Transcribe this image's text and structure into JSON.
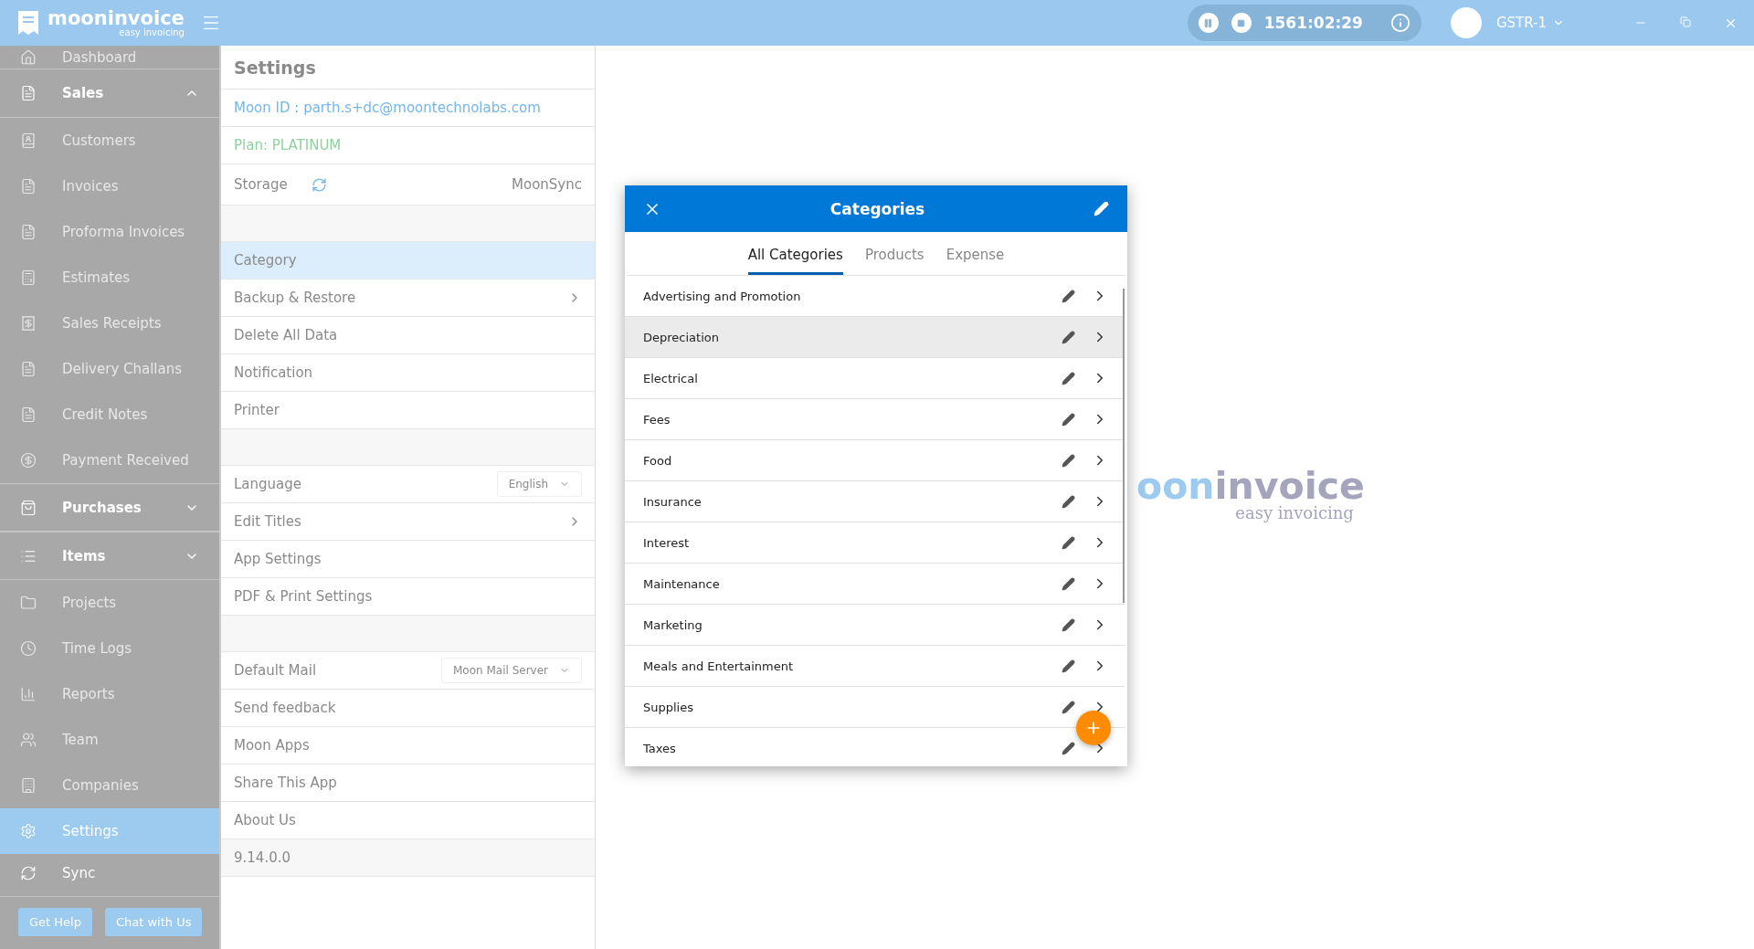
{
  "app": {
    "name": "mooninvoice",
    "tagline": "easy invoicing"
  },
  "timer": {
    "time": "1561:02:29"
  },
  "company": {
    "name": "GSTR-1"
  },
  "sidebar": {
    "items": [
      {
        "label": "Dashboard",
        "kind": "item",
        "selected": false
      },
      {
        "label": "Sales",
        "kind": "section",
        "expanded": true
      },
      {
        "label": "Customers",
        "kind": "item",
        "selected": false
      },
      {
        "label": "Invoices",
        "kind": "item",
        "selected": false
      },
      {
        "label": "Proforma Invoices",
        "kind": "item",
        "selected": false
      },
      {
        "label": "Estimates",
        "kind": "item",
        "selected": false
      },
      {
        "label": "Sales Receipts",
        "kind": "item",
        "selected": false
      },
      {
        "label": "Delivery Challans",
        "kind": "item",
        "selected": false
      },
      {
        "label": "Credit Notes",
        "kind": "item",
        "selected": false
      },
      {
        "label": "Payment Received",
        "kind": "item",
        "selected": false
      },
      {
        "label": "Purchases",
        "kind": "section",
        "expanded": false
      },
      {
        "label": "Items",
        "kind": "section",
        "expanded": false
      },
      {
        "label": "Projects",
        "kind": "item",
        "selected": false
      },
      {
        "label": "Time Logs",
        "kind": "item",
        "selected": false
      },
      {
        "label": "Reports",
        "kind": "item",
        "selected": false
      },
      {
        "label": "Team",
        "kind": "item",
        "selected": false
      },
      {
        "label": "Companies",
        "kind": "item",
        "selected": false
      },
      {
        "label": "Settings",
        "kind": "item",
        "selected": true
      },
      {
        "label": "Sync",
        "kind": "sync"
      }
    ],
    "buttons": [
      "Get Help",
      "Chat with Us"
    ]
  },
  "settings": {
    "title": "Settings",
    "groups": [
      [
        {
          "kind": "id",
          "label": "Moon ID : parth.s+dc@moontechnolabs.com"
        },
        {
          "kind": "plan",
          "label": "Plan: PLATINUM"
        },
        {
          "kind": "storage",
          "label": "Storage",
          "value": "MoonSync"
        }
      ],
      [
        {
          "kind": "row",
          "label": "Category",
          "selected": true
        },
        {
          "kind": "link",
          "label": "Backup & Restore",
          "selected": false
        },
        {
          "kind": "row",
          "label": "Delete All Data",
          "selected": false
        },
        {
          "kind": "row",
          "label": "Notification",
          "selected": false
        },
        {
          "kind": "row",
          "label": "Printer",
          "selected": false
        }
      ],
      [
        {
          "kind": "select",
          "label": "Language",
          "value": "English"
        },
        {
          "kind": "link",
          "label": "Edit Titles",
          "selected": false
        },
        {
          "kind": "row",
          "label": "App Settings",
          "selected": false
        },
        {
          "kind": "row",
          "label": "PDF & Print Settings",
          "selected": false
        }
      ],
      [
        {
          "kind": "select",
          "label": "Default Mail",
          "value": "Moon Mail Server"
        },
        {
          "kind": "row",
          "label": "Send feedback",
          "selected": false
        },
        {
          "kind": "row",
          "label": "Moon Apps",
          "selected": false
        },
        {
          "kind": "row",
          "label": "Share This App",
          "selected": false
        },
        {
          "kind": "row",
          "label": "About Us",
          "selected": false
        },
        {
          "kind": "version",
          "label": "9.14.0.0"
        }
      ]
    ]
  },
  "background_logo": {
    "part_1": "oon",
    "part_2": "invoice",
    "tagline": "easy invoicing"
  },
  "dialog": {
    "title": "Categories",
    "tabs": [
      {
        "label": "All Categories",
        "selected": true
      },
      {
        "label": "Products",
        "selected": false
      },
      {
        "label": "Expense",
        "selected": false
      }
    ],
    "categories": [
      {
        "name": "Advertising and Promotion",
        "highlighted": false
      },
      {
        "name": "Depreciation",
        "highlighted": true
      },
      {
        "name": "Electrical",
        "highlighted": false
      },
      {
        "name": "Fees",
        "highlighted": false
      },
      {
        "name": "Food",
        "highlighted": false
      },
      {
        "name": "Insurance",
        "highlighted": false
      },
      {
        "name": "Interest",
        "highlighted": false
      },
      {
        "name": "Maintenance",
        "highlighted": false
      },
      {
        "name": "Marketing",
        "highlighted": false
      },
      {
        "name": "Meals and Entertainment",
        "highlighted": false
      },
      {
        "name": "Supplies",
        "highlighted": false
      },
      {
        "name": "Taxes",
        "highlighted": false
      }
    ]
  }
}
